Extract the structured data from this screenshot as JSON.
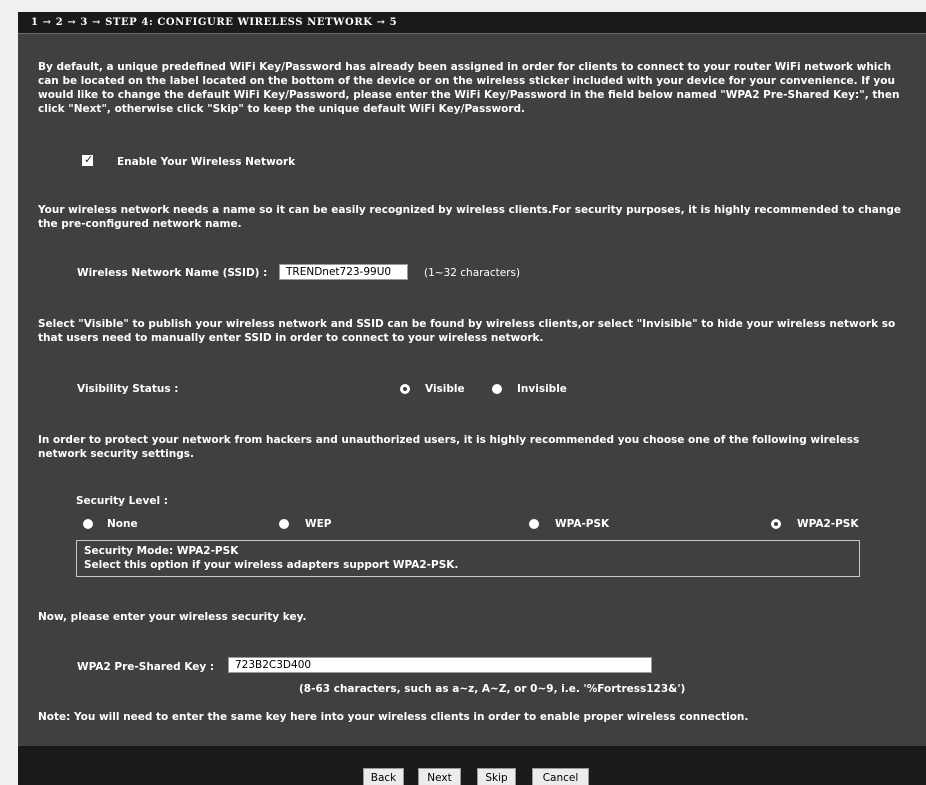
{
  "header": {
    "steps": "1 → 2 → 3 → STEP 4: CONFIGURE WIRELESS NETWORK → 5"
  },
  "intro": {
    "line1": "By default, a unique predefined WiFi Key/Password has already been assigned in order for clients to connect to your router WiFi network which",
    "line2": "can be located on the label located on the bottom of the device or on the wireless sticker included with your device for your convenience. If you",
    "line3": "would like to change the default WiFi Key/Password, please enter the WiFi Key/Password in the field below named \"WPA2 Pre-Shared Key:\", then",
    "line4": "click \"Next\", otherwise click \"Skip\" to keep the unique default WiFi Key/Password."
  },
  "enable_wireless": {
    "label": "Enable Your Wireless Network",
    "checked": true
  },
  "ssid_section": {
    "line1": "Your wireless network needs a name so it can be easily recognized by wireless clients.For security purposes, it is highly recommended to change",
    "line2": "the pre-configured network name.",
    "label": "Wireless Network Name (SSID) :",
    "value": "TRENDnet723-99U0",
    "hint": "(1~32 characters)"
  },
  "visibility_section": {
    "line1": "Select \"Visible\" to publish your wireless network and SSID can be found by wireless clients,or select \"Invisible\" to hide your wireless network so",
    "line2": "that users need to manually enter SSID in order to connect to your wireless network.",
    "label": "Visibility Status :",
    "options": [
      "Visible",
      "Invisible"
    ],
    "selected": "Visible"
  },
  "security_section": {
    "line1": "In order to protect your network from hackers and unauthorized users, it is highly recommended you choose one of the following wireless",
    "line2": "network security settings.",
    "label": "Security Level :",
    "options": [
      "None",
      "WEP",
      "WPA-PSK",
      "WPA2-PSK"
    ],
    "selected": "WPA2-PSK",
    "info_title": "Security Mode: WPA2-PSK",
    "info_desc": "Select this option if your wireless adapters support WPA2-PSK."
  },
  "key_section": {
    "prompt": "Now, please enter your wireless security key.",
    "label": "WPA2 Pre-Shared Key :",
    "value": "723B2C3D400",
    "hint": "(8-63 characters, such as a~z, A~Z, or 0~9, i.e. '%Fortress123&')",
    "note": "Note: You will need to enter the same key here into your wireless clients in order to enable proper wireless connection."
  },
  "buttons": {
    "back": "Back",
    "next": "Next",
    "skip": "Skip",
    "cancel": "Cancel"
  }
}
